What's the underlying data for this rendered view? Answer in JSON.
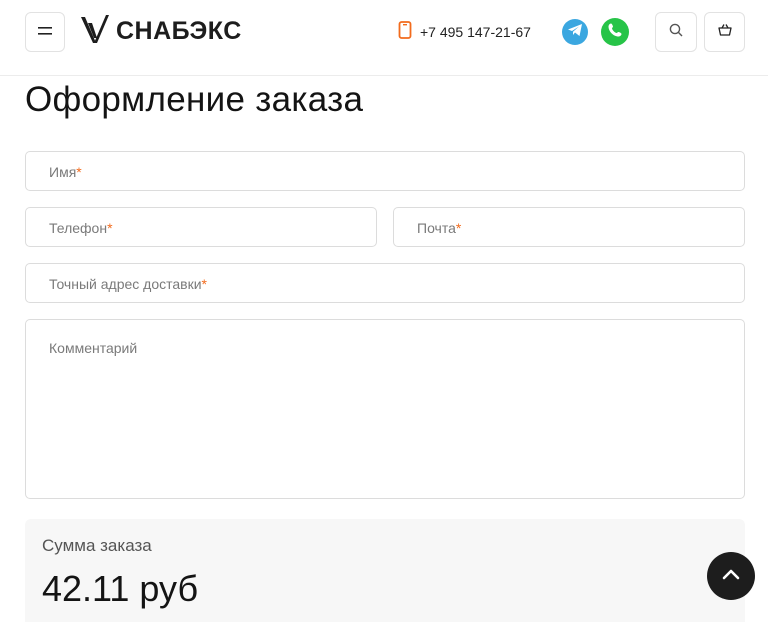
{
  "header": {
    "logo_text": "СНАБЭКС",
    "phone": "+7 495 147-21-67"
  },
  "page": {
    "title": "Оформление заказа"
  },
  "form": {
    "name_label": "Имя",
    "phone_label": "Телефон",
    "email_label": "Почта",
    "address_label": "Точный адрес доставки",
    "comment_label": "Комментарий",
    "required_mark": "*"
  },
  "summary": {
    "label": "Сумма заказа",
    "total": "42.11 руб"
  },
  "colors": {
    "accent": "#f26b1d",
    "telegram": "#3ba7e0",
    "whatsapp": "#27c448"
  }
}
